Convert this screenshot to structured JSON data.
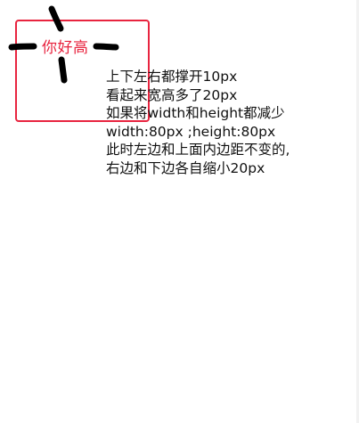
{
  "box": {
    "text": "你好高",
    "accent_color": "#e8243f"
  },
  "explanation": {
    "lines": [
      "上下左右都撑开10px",
      "看起来宽高多了20px",
      "如果将width和height都减少",
      "width:80px ;height:80px",
      "此时左边和上面内边距不变的,",
      "右边和下边各自缩小20px"
    ]
  },
  "marks": {
    "color": "#000000"
  }
}
